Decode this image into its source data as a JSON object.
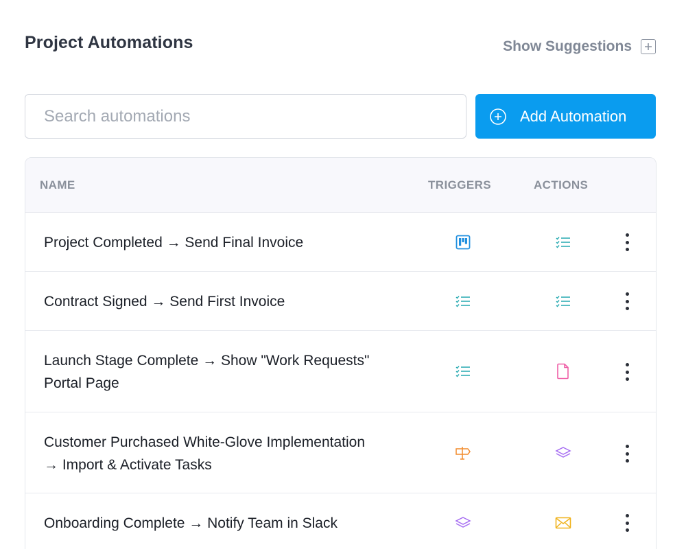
{
  "header": {
    "title": "Project Automations",
    "suggestions_label": "Show Suggestions",
    "suggestions_icon": "plus-square-icon"
  },
  "search": {
    "placeholder": "Search automations",
    "value": ""
  },
  "add_button": {
    "label": "Add Automation",
    "icon": "plus-circle-icon",
    "color": "#0a9cef"
  },
  "table": {
    "columns": {
      "name": "NAME",
      "triggers": "TRIGGERS",
      "actions": "ACTIONS"
    },
    "rows": [
      {
        "line1": "Project Completed → Send Final Invoice",
        "line2": "",
        "trigger_icon": "kanban-board-icon",
        "action_icon": "checklist-icon"
      },
      {
        "line1": "Contract Signed → Send First Invoice",
        "line2": "",
        "trigger_icon": "checklist-icon",
        "action_icon": "checklist-icon"
      },
      {
        "line1": "Launch Stage Complete → Show \"Work Requests\"",
        "line2": "Portal Page",
        "trigger_icon": "checklist-icon",
        "action_icon": "document-icon"
      },
      {
        "line1": "Customer Purchased White-Glove Implementation",
        "line2": "→ Import & Activate Tasks",
        "trigger_icon": "signpost-icon",
        "action_icon": "layers-icon"
      },
      {
        "line1": "Onboarding Complete → Notify Team in Slack",
        "line2": "",
        "trigger_icon": "layers-icon",
        "action_icon": "envelope-icon"
      }
    ]
  },
  "colors": {
    "blue": "#1f8fdf",
    "teal": "#25a9b0",
    "pink": "#ef5fa7",
    "orange": "#f28b2c",
    "purple": "#a66ef2",
    "yellow": "#f0b21c"
  }
}
